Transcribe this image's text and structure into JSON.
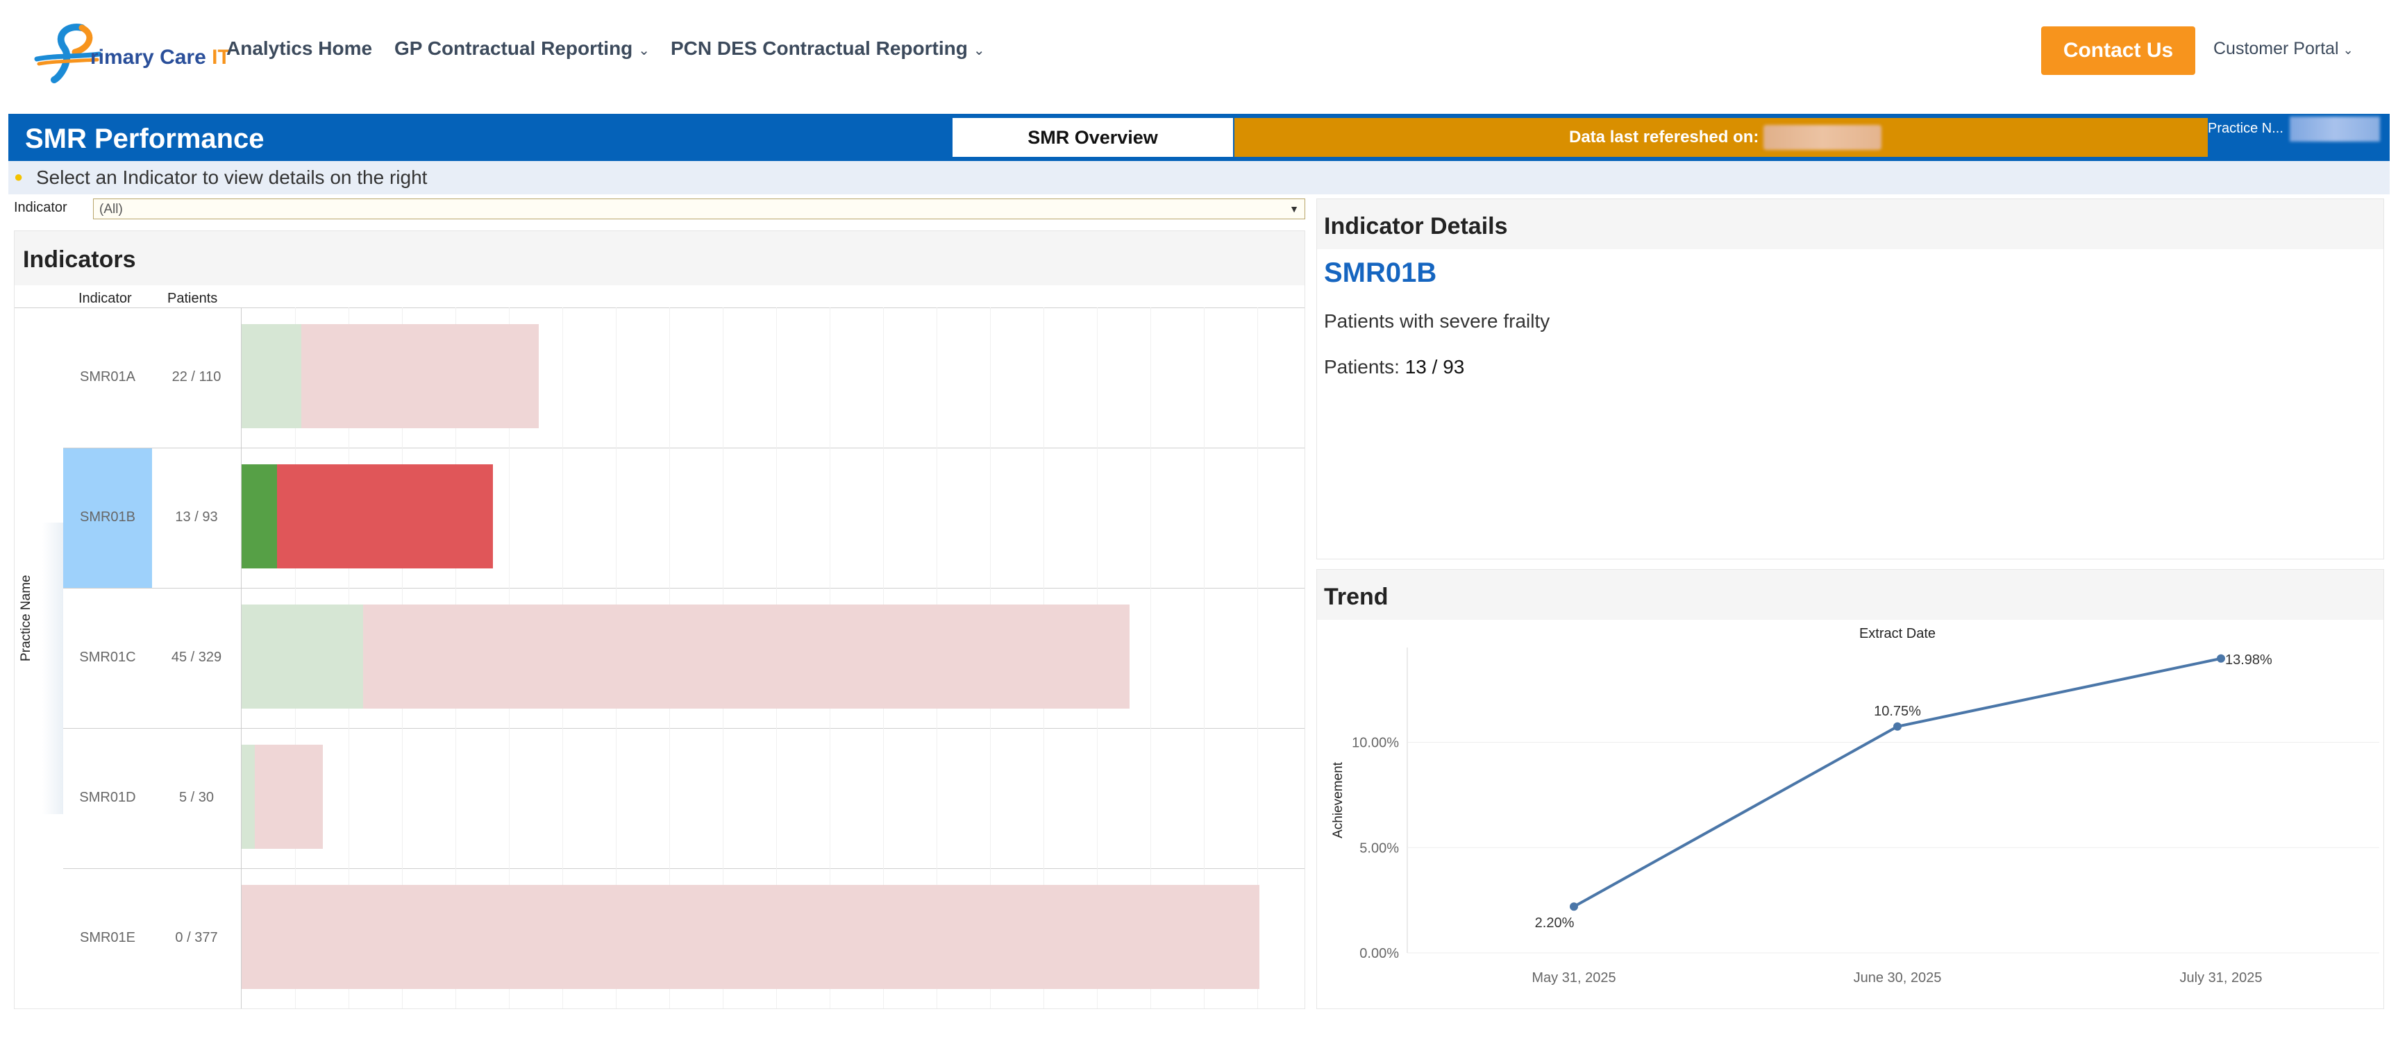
{
  "nav": {
    "logo_text_main": "rimary Care ",
    "logo_text_it": "IT",
    "items": [
      {
        "label": "Analytics Home",
        "has_dropdown": false
      },
      {
        "label": "GP Contractual Reporting",
        "has_dropdown": true
      },
      {
        "label": "PCN DES Contractual Reporting",
        "has_dropdown": true
      }
    ],
    "contact_label": "Contact Us",
    "portal_label": "Customer Portal"
  },
  "header": {
    "title": "SMR Performance",
    "overview_label": "SMR Overview",
    "refresh_label": "Data last refereshed on:",
    "practice_label": "Practice N..."
  },
  "instruction": "Select an Indicator to view details on the right",
  "filter": {
    "label": "Indicator",
    "value": "(All)"
  },
  "indicators": {
    "title": "Indicators",
    "col_indicator": "Indicator",
    "col_patients": "Patients",
    "axis_label": "Practice Name",
    "selected": "SMR01B",
    "rows": [
      {
        "code": "SMR01A",
        "patients": "22 / 110",
        "achieved": 22,
        "total": 110
      },
      {
        "code": "SMR01B",
        "patients": "13 / 93",
        "achieved": 13,
        "total": 93
      },
      {
        "code": "SMR01C",
        "patients": "45 / 329",
        "achieved": 45,
        "total": 329
      },
      {
        "code": "SMR01D",
        "patients": "5 / 30",
        "achieved": 5,
        "total": 30
      },
      {
        "code": "SMR01E",
        "patients": "0 / 377",
        "achieved": 0,
        "total": 377
      }
    ],
    "colors": {
      "achieved": "#d6e6d4",
      "remaining": "#efd6d6",
      "achieved_selected": "#56a046",
      "remaining_selected": "#e05659",
      "selected_cell": "#9ed1fb"
    }
  },
  "details": {
    "title": "Indicator Details",
    "code": "SMR01B",
    "description": "Patients with severe frailty",
    "patients_label": "Patients:",
    "patients_value": "13 / 93"
  },
  "trend": {
    "title": "Trend"
  },
  "chart_data": {
    "type": "line",
    "title": "",
    "xlabel": "Extract Date",
    "ylabel": "Achievement",
    "x": [
      "May 31, 2025",
      "June 30, 2025",
      "July 31, 2025"
    ],
    "series": [
      {
        "values": [
          2.2,
          10.75,
          13.98
        ],
        "labels": [
          "2.20%",
          "10.75%",
          "13.98%"
        ]
      }
    ],
    "yticks": [
      "0.00%",
      "5.00%",
      "10.00%"
    ],
    "ytick_values": [
      0,
      5,
      10
    ],
    "ylim": [
      0,
      14.5
    ],
    "grid": true,
    "line_color": "#4a76a8"
  }
}
